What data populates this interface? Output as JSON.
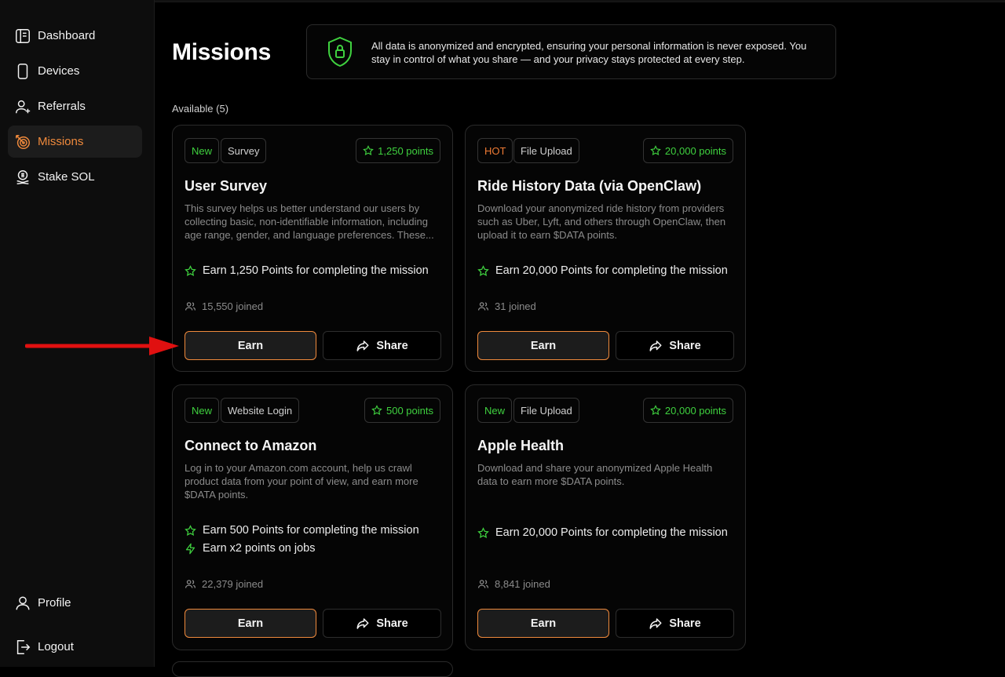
{
  "sidebar": {
    "items": [
      {
        "label": "Dashboard",
        "icon": "dashboard-icon"
      },
      {
        "label": "Devices",
        "icon": "device-icon"
      },
      {
        "label": "Referrals",
        "icon": "referrals-icon"
      },
      {
        "label": "Missions",
        "icon": "target-icon",
        "active": true
      },
      {
        "label": "Stake SOL",
        "icon": "stake-icon"
      }
    ],
    "bottom": [
      {
        "label": "Profile",
        "icon": "user-icon"
      },
      {
        "label": "Logout",
        "icon": "logout-icon"
      }
    ]
  },
  "page": {
    "title": "Missions",
    "privacy_text": "All data is anonymized and encrypted, ensuring your personal information is never exposed. You stay in control of what you share — and your privacy stays protected at every step.",
    "available_label": "Available (5)"
  },
  "colors": {
    "accent": "#f08a3c",
    "green": "#3fd13f",
    "hot": "#ef7b34",
    "annotation_arrow": "#e01010"
  },
  "missions": [
    {
      "tags": [
        "New",
        "Survey"
      ],
      "points": "1,250 points",
      "title": "User Survey",
      "description": "This survey helps us better understand our users by collecting basic, non-identifiable information, including age range, gender, and language preferences. These...",
      "rewards": [
        "Earn 1,250 Points for completing the mission"
      ],
      "joined": "15,550 joined",
      "earn_label": "Earn",
      "share_label": "Share"
    },
    {
      "tags": [
        "HOT",
        "File Upload"
      ],
      "points": "20,000 points",
      "title": "Ride History Data (via OpenClaw)",
      "description": "Download your anonymized ride history from providers such as Uber, Lyft, and others through OpenClaw, then upload it to earn $DATA points.",
      "rewards": [
        "Earn 20,000 Points for completing the mission"
      ],
      "joined": "31 joined",
      "earn_label": "Earn",
      "share_label": "Share"
    },
    {
      "tags": [
        "New",
        "Website Login"
      ],
      "points": "500 points",
      "title": "Connect to Amazon",
      "description": "Log in to your Amazon.com account, help us crawl product data from your point of view, and earn more $DATA points.",
      "rewards": [
        "Earn 500 Points for completing the mission",
        "Earn x2 points on jobs"
      ],
      "joined": "22,379 joined",
      "earn_label": "Earn",
      "share_label": "Share"
    },
    {
      "tags": [
        "New",
        "File Upload"
      ],
      "points": "20,000 points",
      "title": "Apple Health",
      "description": "Download and share your anonymized Apple Health data to earn more $DATA points.",
      "rewards": [
        "Earn 20,000 Points for completing the mission"
      ],
      "joined": "8,841 joined",
      "earn_label": "Earn",
      "share_label": "Share"
    }
  ]
}
